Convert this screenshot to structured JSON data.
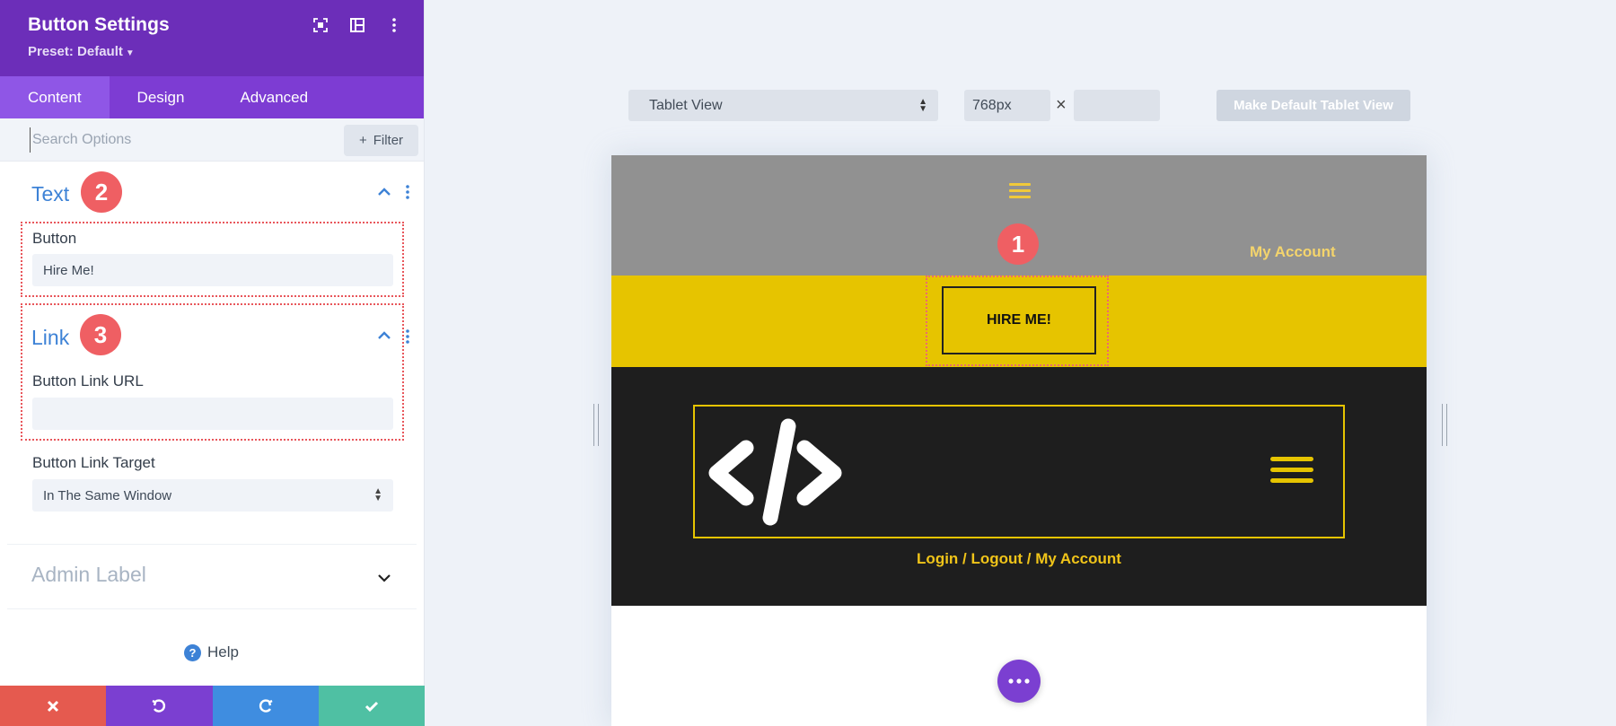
{
  "panel": {
    "title": "Button Settings",
    "preset": "Preset: Default",
    "header_icons": [
      "fullscreen-icon",
      "split-view-icon",
      "more-vertical-icon"
    ],
    "tabs": [
      {
        "label": "Content",
        "active": true
      },
      {
        "label": "Design",
        "active": false
      },
      {
        "label": "Advanced",
        "active": false
      }
    ],
    "search": {
      "placeholder": "Search Options"
    },
    "filter_label": "Filter",
    "text_section": {
      "title": "Text",
      "badge": "2",
      "button_label": "Button",
      "button_value": "Hire Me!"
    },
    "link_section": {
      "title": "Link",
      "badge": "3",
      "url_label": "Button Link URL",
      "url_value": "",
      "target_label": "Button Link Target",
      "target_value": "In The Same Window"
    },
    "admin_label": "Admin Label",
    "help_label": "Help",
    "bottom_actions": [
      {
        "name": "discard",
        "icon": "close-icon",
        "color": "#e55a4f"
      },
      {
        "name": "undo",
        "icon": "undo-icon",
        "color": "#7b3fd1"
      },
      {
        "name": "redo",
        "icon": "redo-icon",
        "color": "#3f8de0"
      },
      {
        "name": "save",
        "icon": "check-icon",
        "color": "#4fc0a3"
      }
    ]
  },
  "preview_controls": {
    "view_select": "Tablet View",
    "width_value": "768px",
    "height_value": "",
    "times_symbol": "×",
    "default_button": "Make Default Tablet View"
  },
  "preview": {
    "badge": "1",
    "my_account_top": "My Account",
    "hire_button": "HIRE ME!",
    "nav_links": "Login / Logout / My Account",
    "colors": {
      "purple": "#6c2eb9",
      "accent_yellow": "#e6c400",
      "dark": "#1e1e1e",
      "gray_header": "#919191",
      "badge_red": "#ef5f63",
      "link_blue": "#3d82d6"
    }
  }
}
